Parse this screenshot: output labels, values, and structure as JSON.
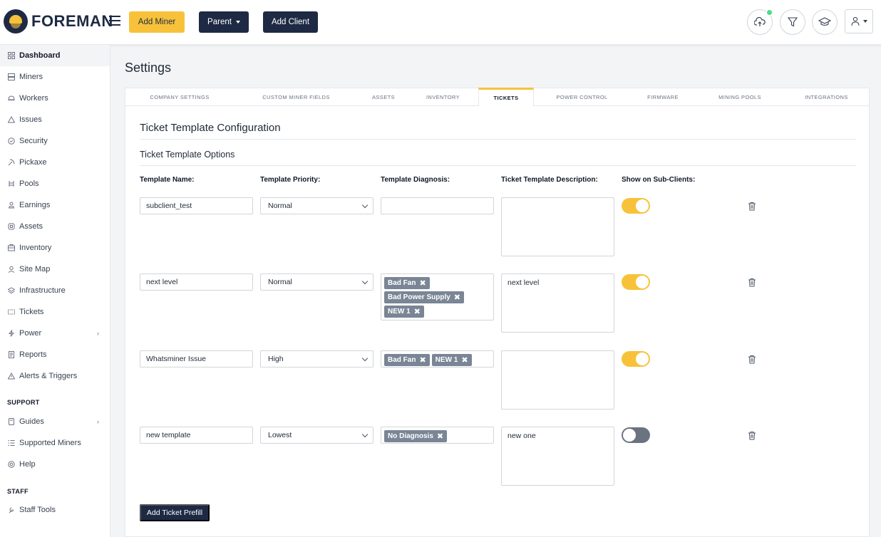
{
  "app": {
    "logo_text": "FOREMAN"
  },
  "topbar": {
    "add_miner_label": "Add Miner",
    "parent_label": "Parent",
    "add_client_label": "Add Client"
  },
  "sidebar": {
    "items": [
      {
        "label": "Dashboard",
        "icon": "grid-icon",
        "active": true
      },
      {
        "label": "Miners",
        "icon": "server-icon"
      },
      {
        "label": "Workers",
        "icon": "worker-icon"
      },
      {
        "label": "Issues",
        "icon": "warning-icon"
      },
      {
        "label": "Security",
        "icon": "shield-icon"
      },
      {
        "label": "Pickaxe",
        "icon": "pickaxe-icon"
      },
      {
        "label": "Pools",
        "icon": "pools-icon"
      },
      {
        "label": "Earnings",
        "icon": "earnings-icon"
      },
      {
        "label": "Assets",
        "icon": "assets-icon"
      },
      {
        "label": "Inventory",
        "icon": "inventory-icon"
      },
      {
        "label": "Site Map",
        "icon": "map-icon"
      },
      {
        "label": "Infrastructure",
        "icon": "layers-icon"
      },
      {
        "label": "Tickets",
        "icon": "ticket-icon"
      },
      {
        "label": "Power",
        "icon": "bolt-icon"
      },
      {
        "label": "Reports",
        "icon": "report-icon"
      },
      {
        "label": "Alerts & Triggers",
        "icon": "alert-icon"
      }
    ],
    "support_heading": "SUPPORT",
    "support_items": [
      {
        "label": "Guides",
        "icon": "book-icon"
      },
      {
        "label": "Supported Miners",
        "icon": "list-icon"
      },
      {
        "label": "Help",
        "icon": "help-icon"
      }
    ],
    "staff_heading": "STAFF",
    "staff_items": [
      {
        "label": "Staff Tools",
        "icon": "tools-icon"
      }
    ]
  },
  "page": {
    "title": "Settings"
  },
  "tabs": [
    {
      "label": "COMPANY SETTINGS"
    },
    {
      "label": "CUSTOM MINER FIELDS"
    },
    {
      "label": "ASSETS"
    },
    {
      "label": "INVENTORY"
    },
    {
      "label": "TICKETS",
      "active": true
    },
    {
      "label": "POWER CONTROL"
    },
    {
      "label": "FIRMWARE"
    },
    {
      "label": "MINING POOLS"
    },
    {
      "label": "INTEGRATIONS"
    }
  ],
  "config": {
    "title": "Ticket Template Configuration",
    "options_title": "Ticket Template Options",
    "columns": {
      "name": "Template Name:",
      "priority": "Template Priority:",
      "diagnosis": "Template Diagnosis:",
      "description": "Ticket Template Description:",
      "subclients": "Show on Sub-Clients:"
    },
    "templates": [
      {
        "name": "subclient_test",
        "priority": "Normal",
        "diagnosis": [],
        "description": "",
        "show_on_subclients": true
      },
      {
        "name": "next level",
        "priority": "Normal",
        "diagnosis": [
          "Bad Fan",
          "Bad Power Supply",
          "NEW 1"
        ],
        "description": "next level",
        "show_on_subclients": true
      },
      {
        "name": "Whatsminer Issue",
        "priority": "High",
        "diagnosis": [
          "Bad Fan",
          "NEW 1"
        ],
        "description": "",
        "show_on_subclients": true
      },
      {
        "name": "new template",
        "priority": "Lowest",
        "diagnosis": [
          "No Diagnosis"
        ],
        "description": "new one",
        "show_on_subclients": false
      }
    ],
    "add_prefill_label": "Add Ticket Prefill"
  },
  "colors": {
    "accent": "#f7c23a",
    "navy": "#1e2a44",
    "tag": "#7a8595",
    "toggle_off": "#6b7280"
  }
}
